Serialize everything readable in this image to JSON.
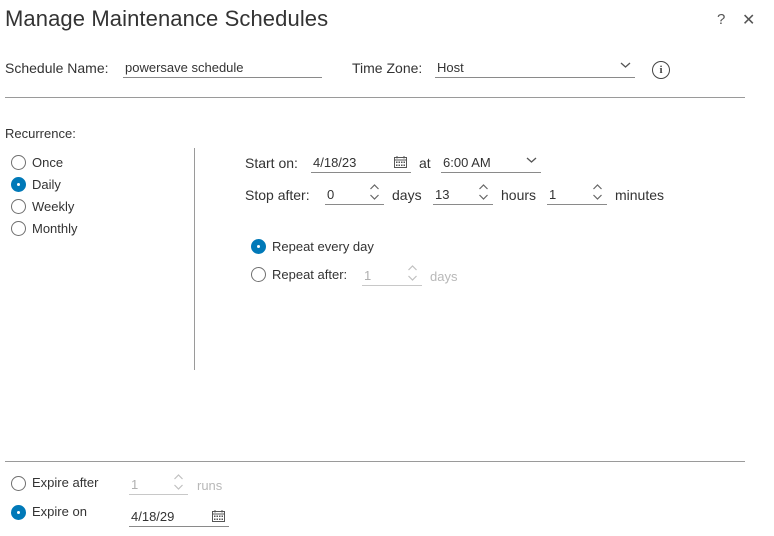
{
  "dialog": {
    "title": "Manage Maintenance Schedules",
    "help": "?",
    "close": "✕"
  },
  "header": {
    "schedule_name_label": "Schedule Name:",
    "schedule_name_value": "powersave schedule",
    "time_zone_label": "Time Zone:",
    "time_zone_value": "Host",
    "info": "i"
  },
  "recurrence": {
    "label": "Recurrence:",
    "options": [
      {
        "label": "Once",
        "selected": false
      },
      {
        "label": "Daily",
        "selected": true
      },
      {
        "label": "Weekly",
        "selected": false
      },
      {
        "label": "Monthly",
        "selected": false
      }
    ]
  },
  "daily": {
    "start_on_label": "Start on:",
    "start_date": "4/18/23",
    "at_label": "at",
    "start_time": "6:00 AM",
    "stop_after_label": "Stop after:",
    "days_value": "0",
    "days_label": "days",
    "hours_value": "13",
    "hours_label": "hours",
    "minutes_value": "1",
    "minutes_label": "minutes",
    "repeat_every_day_label": "Repeat every day",
    "repeat_after_label": "Repeat after:",
    "repeat_after_value": "1",
    "repeat_after_unit": "days",
    "repeat_every_day_selected": true
  },
  "expiry": {
    "expire_after_label": "Expire after",
    "expire_after_value": "1",
    "runs_label": "runs",
    "expire_on_label": "Expire on",
    "expire_on_value": "4/18/29",
    "expire_on_selected": true
  },
  "colors": {
    "accent": "#0079b8",
    "text": "#333333",
    "disabled": "#b8b8b8",
    "divider": "#9a9a9a"
  },
  "icons": [
    "help-icon",
    "close-icon",
    "chevron-down-icon",
    "info-icon",
    "calendar-icon",
    "stepper-icon"
  ]
}
